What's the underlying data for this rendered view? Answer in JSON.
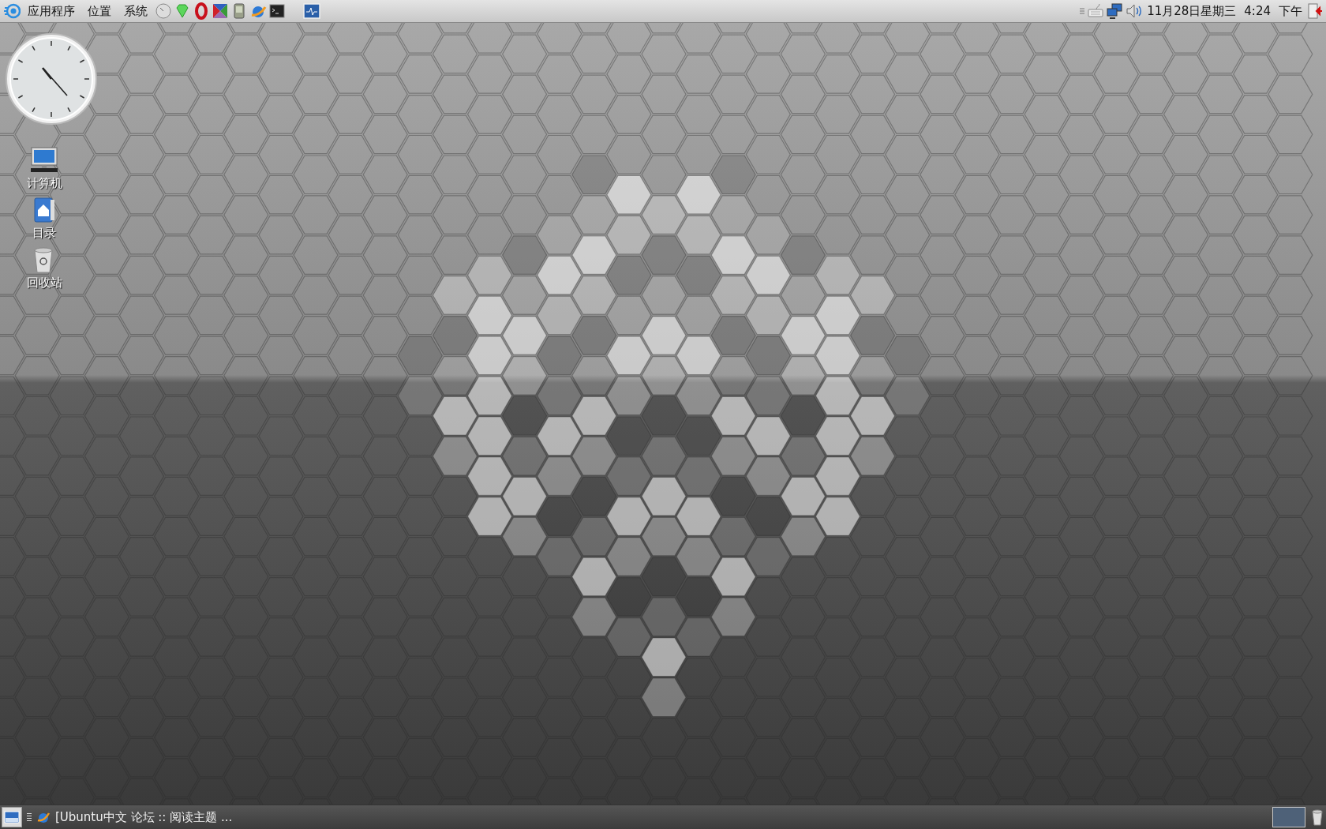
{
  "top_panel": {
    "menus": [
      {
        "label": "应用程序"
      },
      {
        "label": "位置"
      },
      {
        "label": "系统"
      }
    ],
    "date": "11月28日星期三",
    "time": "4:24",
    "period": "下午"
  },
  "desktop": {
    "icons": [
      {
        "kind": "computer",
        "label": "计算机"
      },
      {
        "kind": "home",
        "label": "目录"
      },
      {
        "kind": "trash",
        "label": "回收站"
      }
    ]
  },
  "bottom_panel": {
    "tasks": [
      {
        "title": "[Ubuntu中文 论坛 :: 阅读主题 ..."
      }
    ]
  }
}
